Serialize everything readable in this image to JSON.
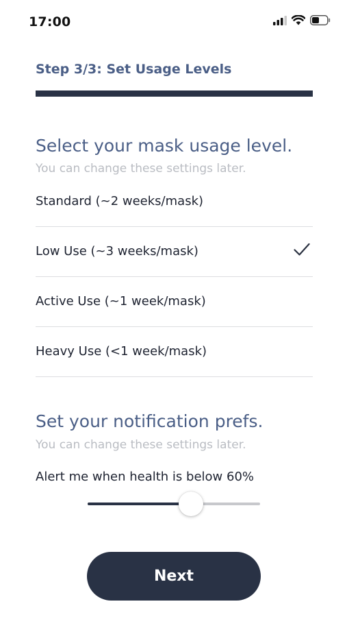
{
  "status_bar": {
    "time": "17:00",
    "icons": [
      "signal-bars-icon",
      "wifi-icon",
      "battery-icon"
    ]
  },
  "header": {
    "step_label": "Step 3/3: Set Usage Levels",
    "progress_fraction": 1.0
  },
  "usage_section": {
    "title": "Select your mask usage level.",
    "subtitle": "You can change these settings later.",
    "options": [
      {
        "label": "Standard (~2 weeks/mask)",
        "selected": false
      },
      {
        "label": "Low Use (~3 weeks/mask)",
        "selected": true
      },
      {
        "label": "Active Use (~1 week/mask)",
        "selected": false
      },
      {
        "label": "Heavy Use (<1 week/mask)",
        "selected": false
      }
    ]
  },
  "notification_section": {
    "title": "Set your notification prefs.",
    "subtitle": "You can change these settings later.",
    "alert_label": "Alert me when health is below 60%",
    "slider_value_percent": 60
  },
  "footer": {
    "next_label": "Next"
  },
  "colors": {
    "accent_dark": "#293245",
    "heading_blue": "#4a5e86",
    "muted_text": "#b9bcc2"
  }
}
